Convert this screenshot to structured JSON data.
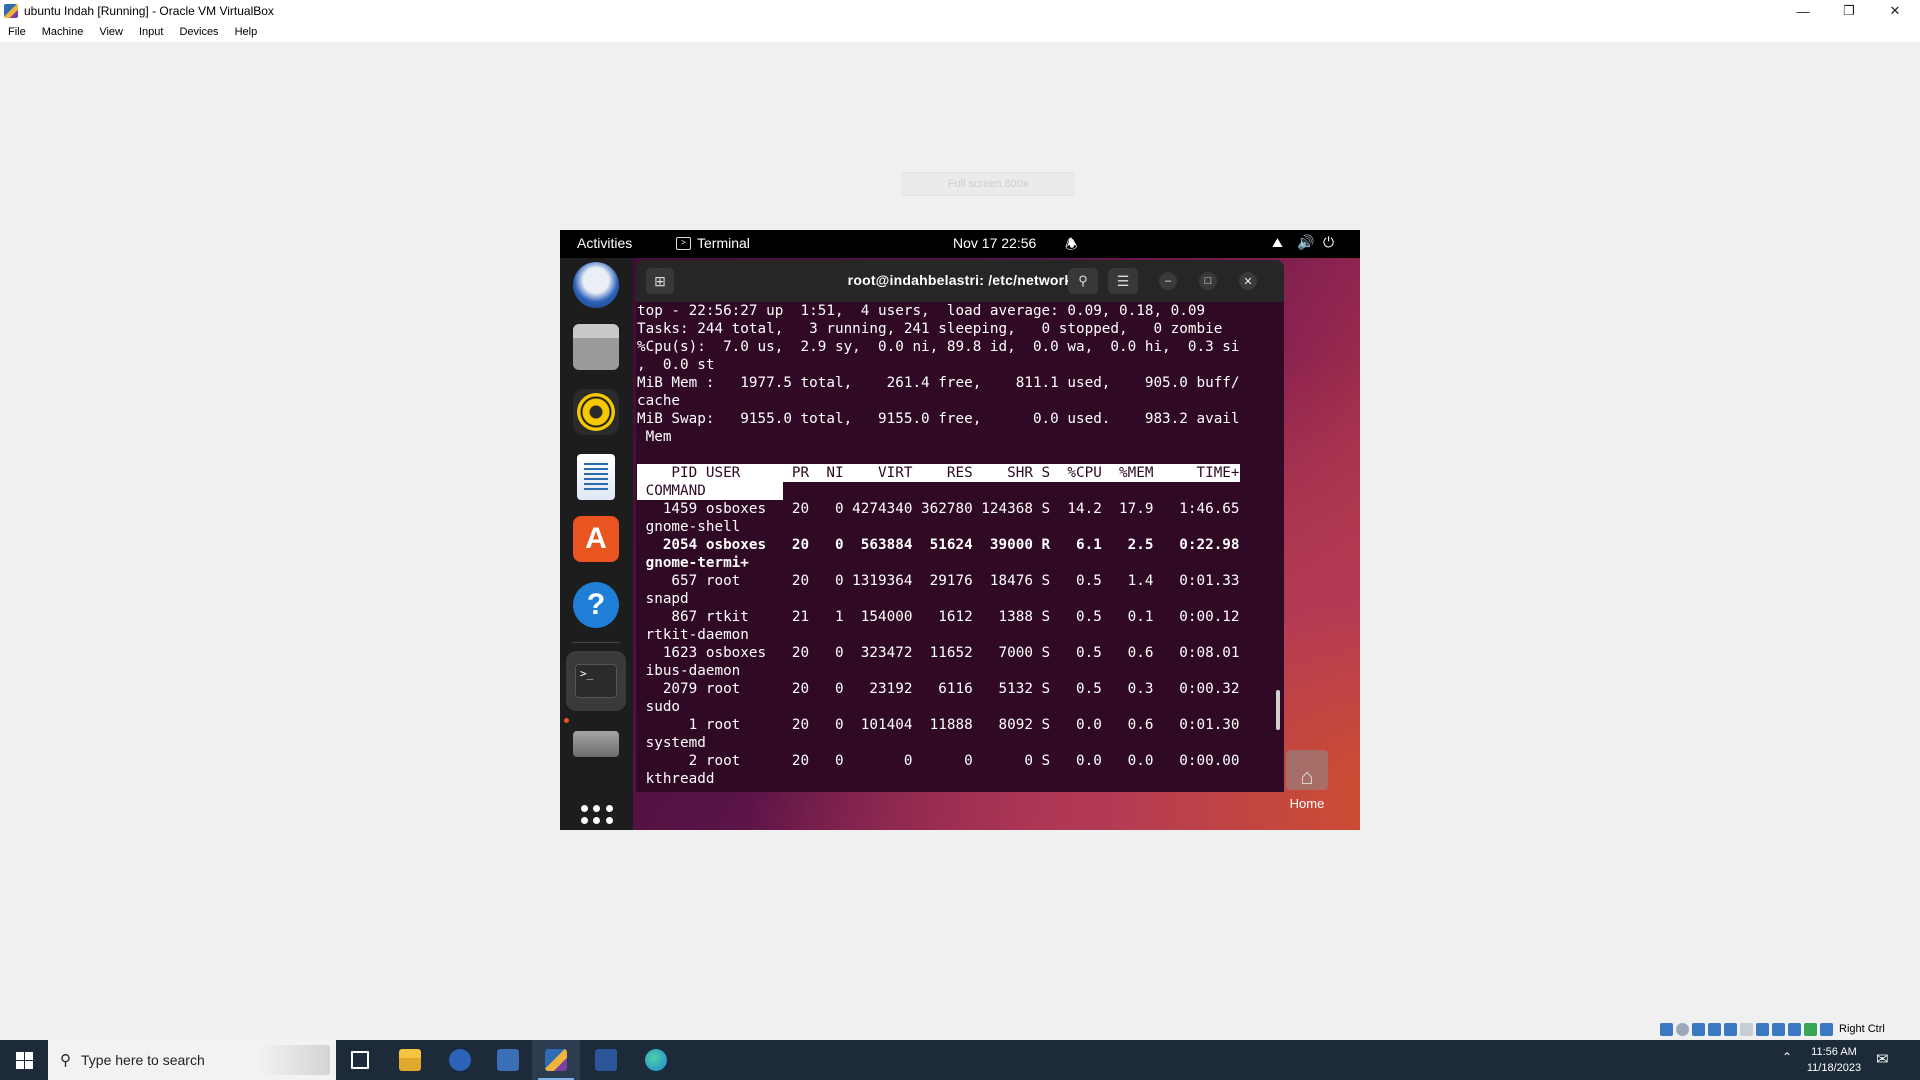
{
  "host": {
    "window_title": "ubuntu Indah [Running] - Oracle VM VirtualBox",
    "menu": [
      "File",
      "Machine",
      "View",
      "Input",
      "Devices",
      "Help"
    ],
    "mini_toolbar_text": "Full screen 800x",
    "host_key": "Right Ctrl"
  },
  "guest": {
    "activities": "Activities",
    "app_name": "Terminal",
    "clock": "Nov 17  22:56",
    "desktop_home_label": "Home"
  },
  "terminal": {
    "title": "root@indahbelastri: /etc/network",
    "lines": [
      "top - 22:56:27 up  1:51,  4 users,  load average: 0.09, 0.18, 0.09",
      "Tasks: 244 total,   3 running, 241 sleeping,   0 stopped,   0 zombie",
      "%Cpu(s):  7.0 us,  2.9 sy,  0.0 ni, 89.8 id,  0.0 wa,  0.0 hi,  0.3 si",
      ",  0.0 st",
      "MiB Mem :   1977.5 total,    261.4 free,    811.1 used,    905.0 buff/",
      "cache",
      "MiB Swap:   9155.0 total,   9155.0 free,      0.0 used.    983.2 avail",
      " Mem",
      ""
    ],
    "header_line1": "    PID USER      PR  NI    VIRT    RES    SHR S  %CPU  %MEM     TIME+",
    "header_line2": " COMMAND         ",
    "processes": [
      {
        "row": "   1459 osboxes   20   0 4274340 362780 124368 S  14.2  17.9   1:46.65",
        "cmd": " gnome-shell",
        "bold": false
      },
      {
        "row": "   2054 osboxes   20   0  563884  51624  39000 R   6.1   2.5   0:22.98",
        "cmd": " gnome-termi+",
        "bold": true
      },
      {
        "row": "    657 root      20   0 1319364  29176  18476 S   0.5   1.4   0:01.33",
        "cmd": " snapd",
        "bold": false
      },
      {
        "row": "    867 rtkit     21   1  154000   1612   1388 S   0.5   0.1   0:00.12",
        "cmd": " rtkit-daemon",
        "bold": false
      },
      {
        "row": "   1623 osboxes   20   0  323472  11652   7000 S   0.5   0.6   0:08.01",
        "cmd": " ibus-daemon",
        "bold": false
      },
      {
        "row": "   2079 root      20   0   23192   6116   5132 S   0.5   0.3   0:00.32",
        "cmd": " sudo",
        "bold": false
      },
      {
        "row": "      1 root      20   0  101404  11888   8092 S   0.0   0.6   0:01.30",
        "cmd": " systemd",
        "bold": false
      },
      {
        "row": "      2 root      20   0       0      0      0 S   0.0   0.0   0:00.00",
        "cmd": " kthreadd",
        "bold": false
      }
    ]
  },
  "taskbar": {
    "search_placeholder": "Type here to search",
    "time": "11:56 AM",
    "date": "11/18/2023"
  },
  "colors": {
    "terminal_bg": "#300a24",
    "taskbar_bg": "#1c2a3a",
    "ubuntu_orange": "#e95420"
  }
}
